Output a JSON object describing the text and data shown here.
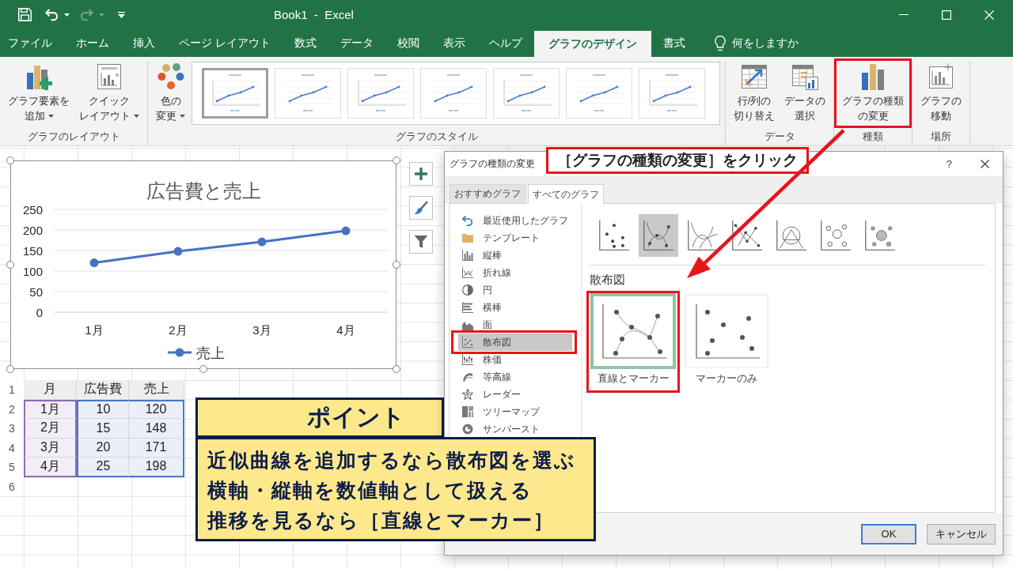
{
  "title_bar": {
    "title": "Book1  -  Excel",
    "quick_access": [
      {
        "kind": "save",
        "dropdown": false,
        "disabled": false
      },
      {
        "kind": "undo",
        "dropdown": true,
        "disabled": false
      },
      {
        "kind": "redo",
        "dropdown": true,
        "disabled": true
      },
      {
        "kind": "customize",
        "dropdown": false,
        "disabled": false
      }
    ]
  },
  "ribbon_tabs": [
    {
      "label": "ファイル",
      "selected": false
    },
    {
      "label": "ホーム",
      "selected": false
    },
    {
      "label": "挿入",
      "selected": false
    },
    {
      "label": "ページ レイアウト",
      "selected": false
    },
    {
      "label": "数式",
      "selected": false
    },
    {
      "label": "データ",
      "selected": false
    },
    {
      "label": "校閲",
      "selected": false
    },
    {
      "label": "表示",
      "selected": false
    },
    {
      "label": "ヘルプ",
      "selected": false
    },
    {
      "label": "グラフのデザイン",
      "selected": true
    },
    {
      "label": "書式",
      "selected": false
    }
  ],
  "tell_me": {
    "placeholder": "何をしますか"
  },
  "ribbon_groups": [
    {
      "label": "グラフのレイアウト",
      "controls": [
        {
          "kind": "add-element",
          "lines": [
            "グラフ要素を",
            "追加"
          ],
          "dropdown": true,
          "highlighted": false
        },
        {
          "kind": "quick-layout",
          "lines": [
            "クイック",
            "レイアウト"
          ],
          "dropdown": true,
          "highlighted": false
        }
      ]
    },
    {
      "label": "グラフのスタイル",
      "controls": [
        {
          "kind": "colors",
          "lines": [
            "色の",
            "変更"
          ],
          "dropdown": true,
          "highlighted": false
        }
      ],
      "styles": [
        {
          "selected": true
        },
        {
          "selected": false
        },
        {
          "selected": false
        },
        {
          "selected": false
        },
        {
          "selected": false
        },
        {
          "selected": false
        },
        {
          "selected": false
        }
      ]
    },
    {
      "label": "データ",
      "controls": [
        {
          "kind": "switch-row-column",
          "lines": [
            "行/列の",
            "切り替え"
          ],
          "dropdown": false,
          "highlighted": false
        },
        {
          "kind": "select-data",
          "lines": [
            "データの",
            "選択"
          ],
          "dropdown": false,
          "highlighted": false
        }
      ]
    },
    {
      "label": "種類",
      "controls": [
        {
          "kind": "change-type",
          "lines": [
            "グラフの種類",
            "の変更"
          ],
          "dropdown": false,
          "highlighted": true
        }
      ]
    },
    {
      "label": "場所",
      "controls": [
        {
          "kind": "move-chart",
          "lines": [
            "グラフの",
            "移動"
          ],
          "dropdown": false,
          "highlighted": false
        }
      ]
    }
  ],
  "chart": {
    "chart_data": {
      "type": "line",
      "title": "広告費と売上",
      "categories": [
        "1月",
        "2月",
        "3月",
        "4月"
      ],
      "series": [
        {
          "name": "売上",
          "color": "#4472c4",
          "marker": true,
          "values": [
            120,
            148,
            171,
            198
          ]
        }
      ],
      "ylim": [
        0,
        250
      ],
      "yticks": [
        0,
        50,
        100,
        150,
        200,
        250
      ],
      "grid": true
    }
  },
  "chart_buttons": [
    {
      "kind": "add"
    },
    {
      "kind": "style"
    },
    {
      "kind": "filter"
    }
  ],
  "sheet": {
    "row_numbers": [
      "1",
      "2",
      "3",
      "4",
      "5",
      "6"
    ],
    "columns": [
      "月",
      "広告費",
      "売上"
    ],
    "rows": [
      [
        "1月",
        "10",
        "120"
      ],
      [
        "2月",
        "15",
        "148"
      ],
      [
        "3月",
        "20",
        "171"
      ],
      [
        "4月",
        "25",
        "198"
      ]
    ]
  },
  "dialog": {
    "title": "グラフの種類の変更",
    "help_label": "?",
    "tabs": [
      {
        "label": "おすすめグラフ",
        "selected": false
      },
      {
        "label": "すべてのグラフ",
        "selected": true
      }
    ],
    "categories": [
      {
        "kind": "recent",
        "label": "最近使用したグラフ",
        "selected": false,
        "highlighted": false
      },
      {
        "kind": "template",
        "label": "テンプレート",
        "selected": false,
        "highlighted": false
      },
      {
        "kind": "column",
        "label": "縦棒",
        "selected": false,
        "highlighted": false
      },
      {
        "kind": "line",
        "label": "折れ線",
        "selected": false,
        "highlighted": false
      },
      {
        "kind": "pie",
        "label": "円",
        "selected": false,
        "highlighted": false
      },
      {
        "kind": "bar",
        "label": "横棒",
        "selected": false,
        "highlighted": false
      },
      {
        "kind": "area",
        "label": "面",
        "selected": false,
        "highlighted": false
      },
      {
        "kind": "scatter",
        "label": "散布図",
        "selected": true,
        "highlighted": true
      },
      {
        "kind": "stock",
        "label": "株価",
        "selected": false,
        "highlighted": false
      },
      {
        "kind": "surface",
        "label": "等高線",
        "selected": false,
        "highlighted": false
      },
      {
        "kind": "radar",
        "label": "レーダー",
        "selected": false,
        "highlighted": false
      },
      {
        "kind": "treemap",
        "label": "ツリーマップ",
        "selected": false,
        "highlighted": false
      },
      {
        "kind": "sunburst",
        "label": "サンバースト",
        "selected": false,
        "highlighted": false
      }
    ],
    "subtypes": [
      {
        "kind": "markers",
        "selected": false
      },
      {
        "kind": "smooth-markers",
        "selected": true
      },
      {
        "kind": "smooth",
        "selected": false
      },
      {
        "kind": "line-markers",
        "selected": false
      },
      {
        "kind": "lines",
        "selected": false
      },
      {
        "kind": "bubble",
        "selected": false
      },
      {
        "kind": "bubble-3d",
        "selected": false
      }
    ],
    "section_title": "散布図",
    "options": [
      {
        "kind": "smooth-markers",
        "label": "直線とマーカー",
        "selected": true,
        "highlighted": true
      },
      {
        "kind": "markers",
        "label": "マーカーのみ",
        "selected": false,
        "highlighted": false
      }
    ],
    "buttons": [
      {
        "label": "OK",
        "default": true
      },
      {
        "label": "キャンセル",
        "default": false
      }
    ]
  },
  "instruction": {
    "text": "［グラフの種類の変更］をクリック"
  },
  "point_box": {
    "title": "ポイント",
    "lines": [
      "近似曲線を追加するなら散布図を選ぶ",
      "横軸・縦軸を数値軸として扱える",
      "推移を見るなら［直線とマーカー］"
    ]
  }
}
